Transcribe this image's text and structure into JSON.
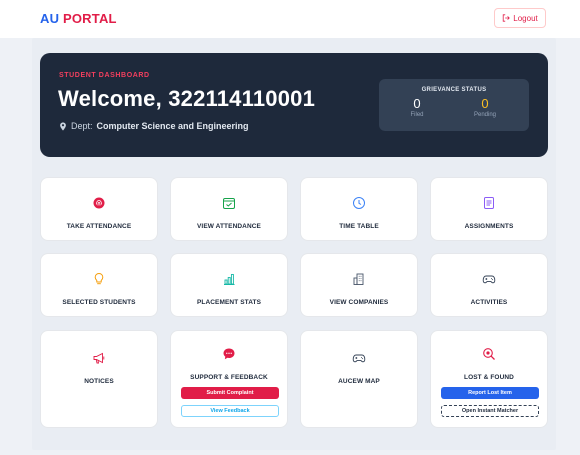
{
  "header": {
    "brand_au": "AU",
    "brand_portal": "PORTAL",
    "logout_label": "Logout"
  },
  "hero": {
    "eyebrow": "STUDENT DASHBOARD",
    "welcome": "Welcome, 322114110001",
    "dept_prefix": "Dept:",
    "dept_value": "Computer Science and Engineering"
  },
  "grievance": {
    "title": "GRIEVANCE STATUS",
    "filed_count": "0",
    "filed_label": "Filed",
    "pending_count": "0",
    "pending_label": "Pending"
  },
  "cards": {
    "take_attendance": "TAKE ATTENDANCE",
    "view_attendance": "VIEW ATTENDANCE",
    "time_table": "TIME TABLE",
    "assignments": "ASSIGNMENTS",
    "selected_students": "SELECTED STUDENTS",
    "placement_stats": "PLACEMENT STATS",
    "view_companies": "VIEW COMPANIES",
    "activities": "ACTIVITIES",
    "notices": "NOTICES",
    "support_feedback": "SUPPORT & FEEDBACK",
    "submit_complaint": "Submit Complaint",
    "view_feedback": "View Feedback",
    "aucew_map": "AUCEW MAP",
    "lost_found": "LOST & FOUND",
    "report_lost_item": "Report Lost Item",
    "open_instant_matcher": "Open Instant Matcher"
  },
  "colors": {
    "accent_blue": "#2563eb",
    "accent_red": "#e11d48",
    "hero_bg": "#1e293b",
    "pending_amber": "#fbbf24"
  }
}
